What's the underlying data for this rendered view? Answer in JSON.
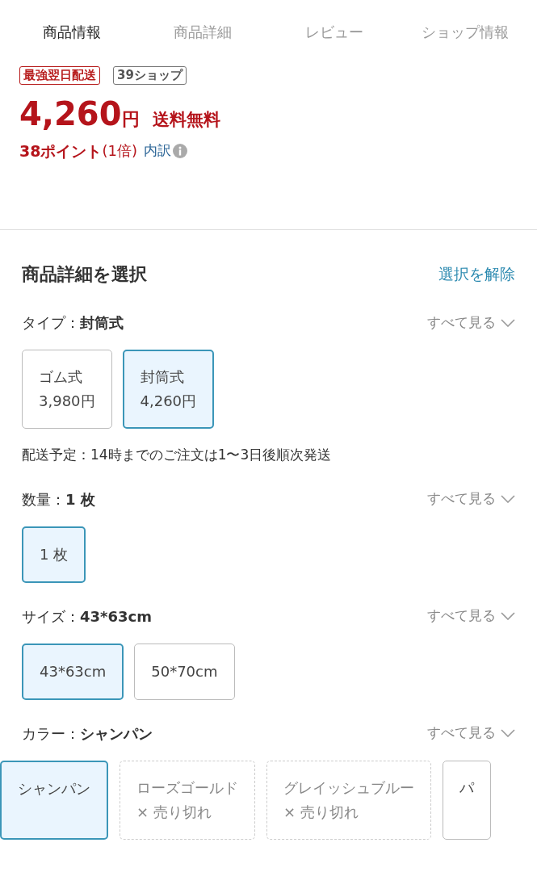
{
  "tabs": [
    {
      "label": "商品情報",
      "selected": true
    },
    {
      "label": "商品詳細",
      "selected": false
    },
    {
      "label": "レビュー",
      "selected": false
    },
    {
      "label": "ショップ情報",
      "selected": false
    }
  ],
  "badges": [
    {
      "label": "最強翌日配送",
      "kind": "delivery"
    },
    {
      "label": "39ショップ",
      "kind": "shop"
    }
  ],
  "price": {
    "amount": "4,260",
    "unit": "円",
    "shipping": "送料無料"
  },
  "points": {
    "text": "38ポイント",
    "rate": "(1倍)",
    "breakdown": "内訳"
  },
  "selection": {
    "title": "商品詳細を選択",
    "clear": "選択を解除",
    "groups": [
      {
        "label": "タイプ：",
        "value": "封筒式",
        "see_all": "すべて見る",
        "options": [
          {
            "lines": [
              "ゴム式",
              "3,980円"
            ],
            "selected": false,
            "kind": "available"
          },
          {
            "lines": [
              "封筒式",
              "4,260円"
            ],
            "selected": true,
            "kind": "available"
          }
        ],
        "note": "配送予定：14時までのご注文は1〜3日後順次発送"
      },
      {
        "label": "数量：",
        "value": "1 枚",
        "see_all": "すべて見る",
        "options": [
          {
            "lines": [
              "1 枚"
            ],
            "selected": true,
            "kind": "available"
          }
        ]
      },
      {
        "label": "サイズ：",
        "value": "43*63cm",
        "see_all": "すべて見る",
        "options": [
          {
            "lines": [
              "43*63cm"
            ],
            "selected": true,
            "kind": "available"
          },
          {
            "lines": [
              "50*70cm"
            ],
            "selected": false,
            "kind": "available"
          }
        ]
      },
      {
        "label": "カラー：",
        "value": "シャンパン",
        "see_all": "すべて見る",
        "options": [
          {
            "lines": [
              "シャンパン"
            ],
            "selected": true,
            "kind": "available"
          },
          {
            "lines": [
              "ローズゴールド",
              "× 売り切れ"
            ],
            "selected": false,
            "kind": "soldout"
          },
          {
            "lines": [
              "グレイッシュブルー",
              "× 売り切れ"
            ],
            "selected": false,
            "kind": "soldout"
          },
          {
            "lines": [
              "パ"
            ],
            "selected": false,
            "kind": "available"
          }
        ]
      }
    ]
  }
}
